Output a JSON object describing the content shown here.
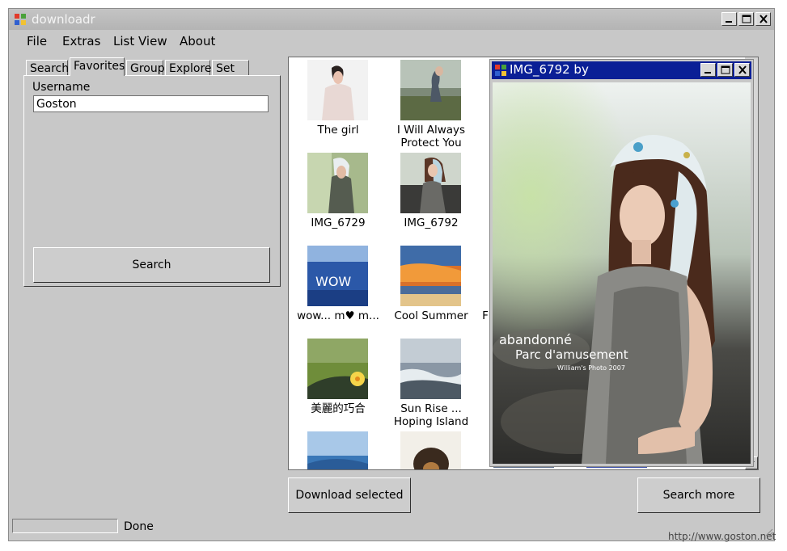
{
  "window": {
    "title": "downloadr"
  },
  "menu": [
    "File",
    "Extras",
    "List View",
    "About"
  ],
  "tabs": [
    "Search",
    "Favorites",
    "Group",
    "Explore",
    "Set"
  ],
  "active_tab": "Favorites",
  "form": {
    "username_label": "Username",
    "username_value": "Goston",
    "search_button": "Search"
  },
  "items": [
    {
      "caption": "The girl"
    },
    {
      "caption": "I Will Always Protect You"
    },
    {
      "caption": "IMG_6729"
    },
    {
      "caption": "IMG_6792"
    },
    {
      "caption": "wow... m♥ m..."
    },
    {
      "caption": "Cool Summer"
    },
    {
      "caption": "美麗的巧合"
    },
    {
      "caption": "Sun Rise ... Hoping Island"
    }
  ],
  "partial_caption": "F",
  "popup": {
    "title": "IMG_6792 by",
    "watermark_line1": "abandonné",
    "watermark_line2": "Parc d'amusement",
    "watermark_line3": "William's Photo 2007"
  },
  "buttons": {
    "download": "Download selected",
    "search_more": "Search more"
  },
  "status": {
    "text": "Done"
  },
  "footer": {
    "watermark": "http://www.goston.net"
  }
}
